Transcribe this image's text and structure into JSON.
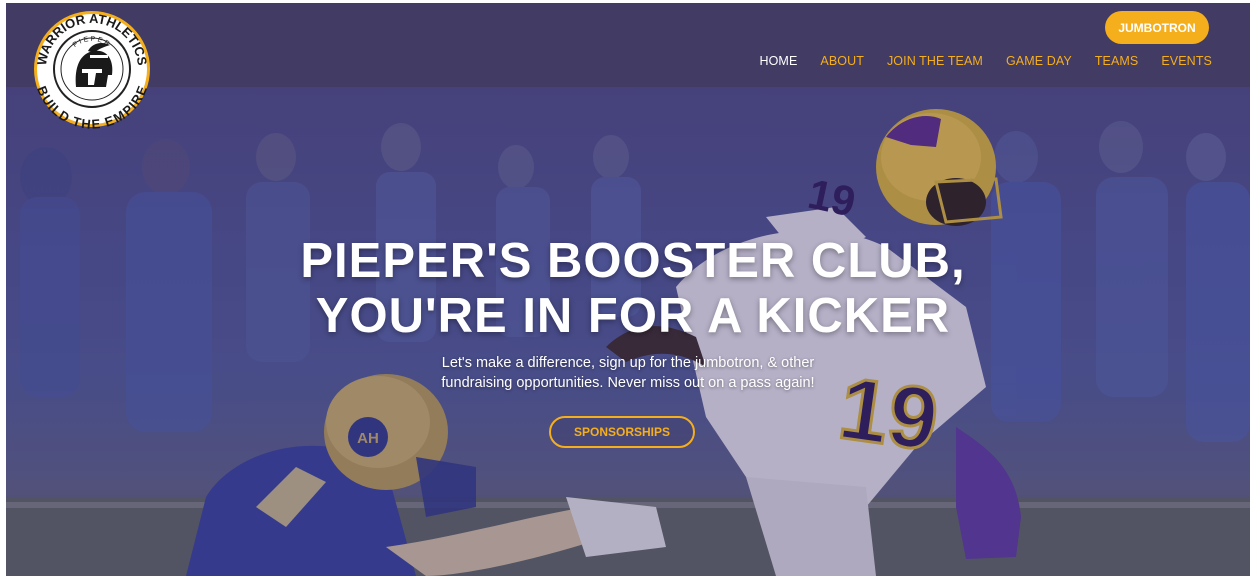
{
  "logo": {
    "top_text": "WARRIOR ATHLETICS",
    "bottom_text": "BUILD THE EMPIRE",
    "school_name": "PIEPER",
    "school_sub": "HIGH SCHOOL"
  },
  "header": {
    "jumbotron_label": "JUMBOTRON",
    "nav": [
      {
        "label": "HOME",
        "active": true
      },
      {
        "label": "ABOUT",
        "active": false
      },
      {
        "label": "JOIN THE TEAM",
        "active": false
      },
      {
        "label": "GAME DAY",
        "active": false
      },
      {
        "label": "TEAMS",
        "active": false
      },
      {
        "label": "EVENTS",
        "active": false
      }
    ]
  },
  "hero": {
    "headline_line1": "PIEPER'S BOOSTER CLUB,",
    "headline_line2": "YOU'RE IN FOR A KICKER",
    "subtext_line1": "Let's make a difference, sign up for the jumbotron, & other",
    "subtext_line2": "fundraising opportunities. Never miss out on a pass again!",
    "cta_label": "SPONSORSHIPS",
    "jersey_number": "19",
    "opponent_helmet_logo": "AH"
  },
  "colors": {
    "nav_bg": "#423b64",
    "accent_gold": "#f5ae1c",
    "nav_active": "#ffffff",
    "overlay_purple": "#382c60"
  }
}
